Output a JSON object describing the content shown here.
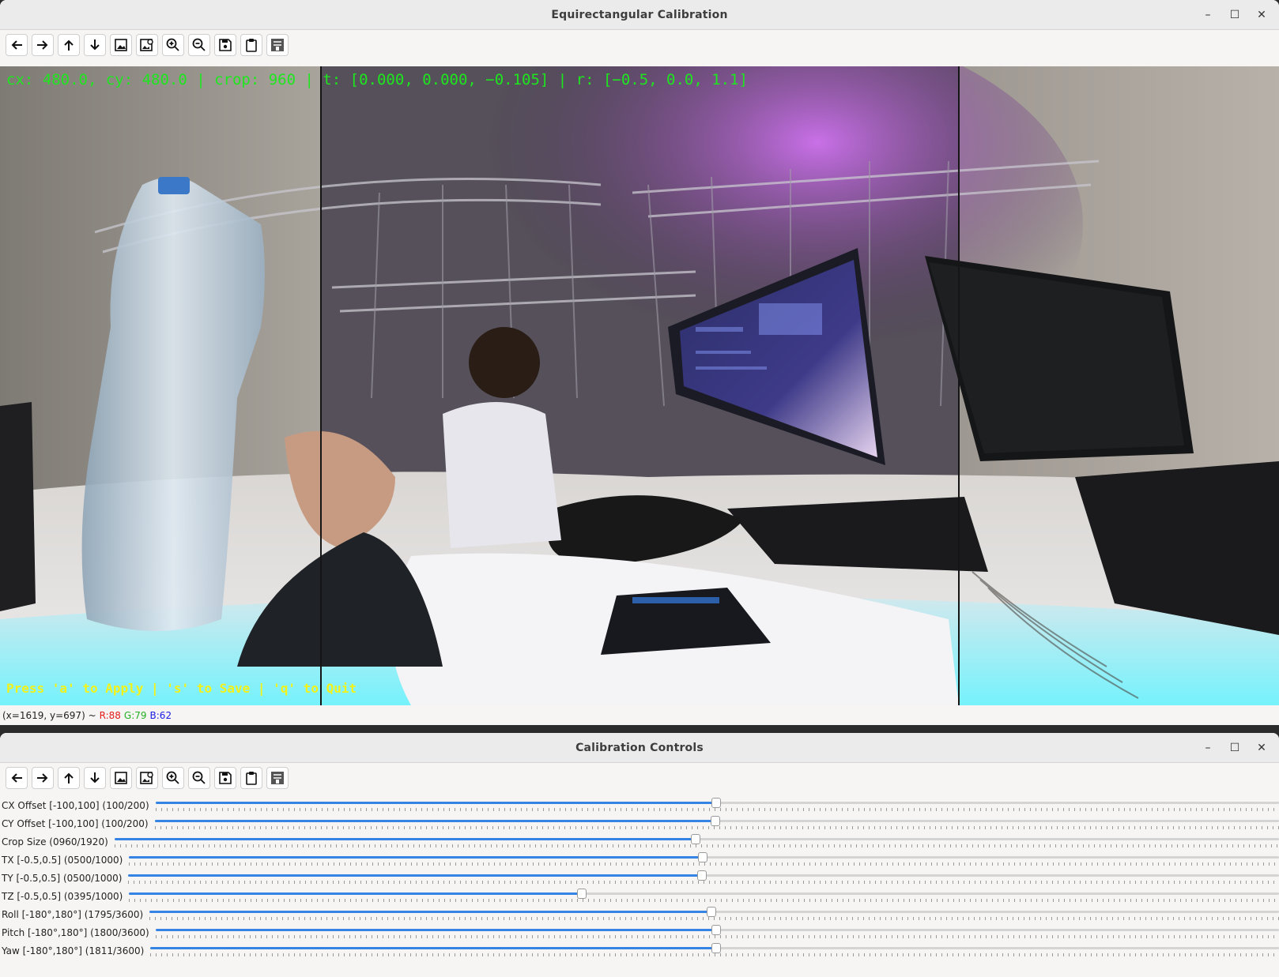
{
  "main_window": {
    "title": "Equirectangular Calibration",
    "controls": {
      "minimize": "–",
      "maximize": "☐",
      "close": "✕"
    },
    "toolbar": [
      "arrow-left-icon",
      "arrow-right-icon",
      "arrow-up-icon",
      "arrow-down-icon",
      "image-icon",
      "image-settings-icon",
      "zoom-in-icon",
      "zoom-out-icon",
      "save-icon",
      "clipboard-icon",
      "properties-icon"
    ],
    "overlay_top": "cx: 480.0, cy: 480.0 | crop: 960 | t: [0.000, 0.000, −0.105] | r: [−0.5, 0.0, 1.1]",
    "overlay_bottom": "Press 'a' to Apply | 's' to Save | 'q' to Quit",
    "overlay_top_color": "#1ee61e",
    "overlay_bottom_color": "#f2f21a",
    "status": {
      "coords": "(x=1619, y=697) ~",
      "r": "R:88",
      "g": "G:79",
      "b": "B:62"
    }
  },
  "controls_window": {
    "title": "Calibration Controls",
    "controls": {
      "minimize": "–",
      "maximize": "☐",
      "close": "✕"
    },
    "toolbar": [
      "arrow-left-icon",
      "arrow-right-icon",
      "arrow-up-icon",
      "arrow-down-icon",
      "image-icon",
      "image-settings-icon",
      "zoom-in-icon",
      "zoom-out-icon",
      "save-icon",
      "clipboard-icon",
      "properties-icon"
    ],
    "accent": "#3584e4",
    "sliders": [
      {
        "label": "CX Offset [-100,100] (100/200)",
        "value": 100,
        "max": 200
      },
      {
        "label": "CY Offset [-100,100] (100/200)",
        "value": 100,
        "max": 200
      },
      {
        "label": "Crop Size  (0960/1920)",
        "value": 960,
        "max": 1920
      },
      {
        "label": "TX [-0.5,0.5] (0500/1000)",
        "value": 500,
        "max": 1000
      },
      {
        "label": "TY [-0.5,0.5] (0500/1000)",
        "value": 500,
        "max": 1000
      },
      {
        "label": "TZ [-0.5,0.5] (0395/1000)",
        "value": 395,
        "max": 1000
      },
      {
        "label": "Roll [-180°,180°] (1795/3600)",
        "value": 1795,
        "max": 3600
      },
      {
        "label": "Pitch [-180°,180°] (1800/3600)",
        "value": 1800,
        "max": 3600
      },
      {
        "label": "Yaw [-180°,180°] (1811/3600)",
        "value": 1811,
        "max": 3600
      }
    ]
  }
}
